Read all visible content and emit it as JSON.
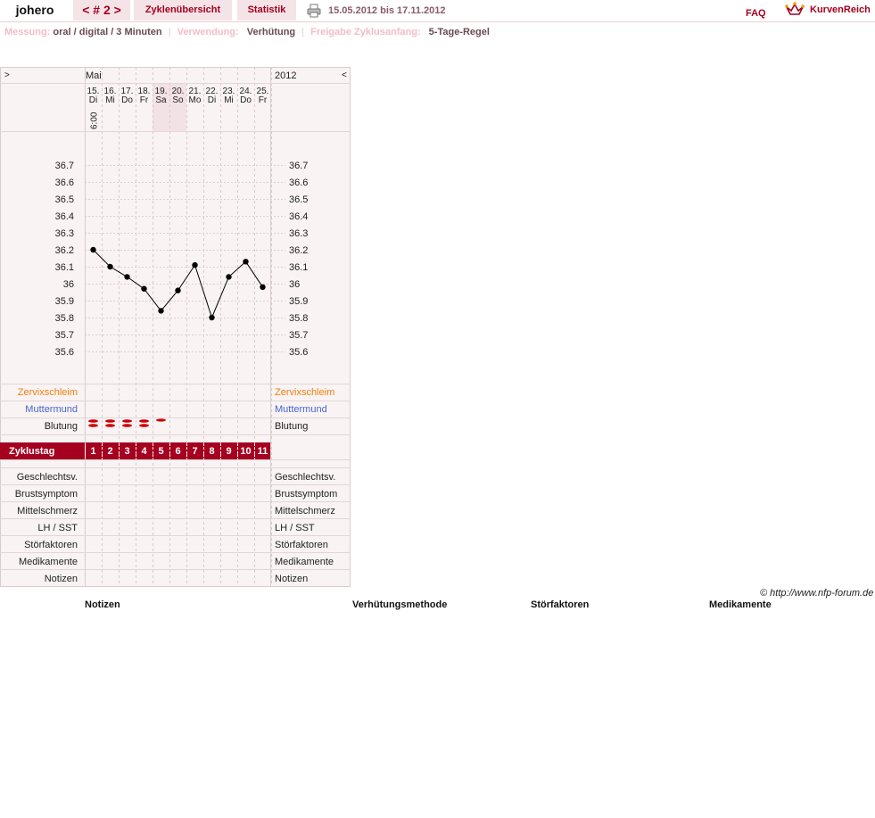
{
  "header": {
    "user": "johero",
    "cycle_nav": "< # 2 >",
    "tab_overview": "Zyklenübersicht",
    "tab_statistics": "Statistik",
    "print_icon": "printer-icon",
    "date_range": "15.05.2012 bis 17.11.2012",
    "faq": "FAQ",
    "logo_icon": "crown-icon",
    "logo_text": "KurvenReich"
  },
  "info": {
    "measurement_label": "Messung:",
    "measurement_value": "oral / digital / 3 Minuten",
    "usage_label": "Verwendung:",
    "usage_value": "Verhütung",
    "release_label": "Freigabe Zyklusanfang:",
    "release_value": "5-Tage-Regel"
  },
  "colors": {
    "accent": "#a5001f",
    "panel_bg": "#f9f3f3",
    "weekend_bg": "#f2e2e5",
    "cervix": "#f08010",
    "cervix_pos": "#4466cc",
    "bleeding": "#cc0000"
  },
  "chart_data": {
    "type": "line",
    "month": "Mai",
    "year": "2012",
    "prev_label": ">",
    "next_label": "<",
    "time_label": "6:00",
    "dates": [
      "15.",
      "16.",
      "17.",
      "18.",
      "19.",
      "20.",
      "21.",
      "22.",
      "23.",
      "24.",
      "25."
    ],
    "weekdays": [
      "Di",
      "Mi",
      "Do",
      "Fr",
      "Sa",
      "So",
      "Mo",
      "Di",
      "Mi",
      "Do",
      "Fr"
    ],
    "weekend_columns": [
      4,
      5
    ],
    "y_ticks": [
      "36.7",
      "36.6",
      "36.5",
      "36.4",
      "36.3",
      "36.2",
      "36.1",
      "36",
      "35.9",
      "35.8",
      "35.7",
      "35.6"
    ],
    "ylim": [
      35.6,
      36.7
    ],
    "temperatures": [
      36.2,
      36.1,
      36.04,
      35.97,
      35.84,
      35.96,
      36.11,
      35.8,
      36.04,
      36.13,
      35.98
    ],
    "bleeding": [
      "heavy",
      "heavy",
      "heavy",
      "heavy",
      "light",
      "",
      "",
      "",
      "",
      "",
      ""
    ],
    "cycle_days": [
      "1",
      "2",
      "3",
      "4",
      "5",
      "6",
      "7",
      "8",
      "9",
      "10",
      "11"
    ]
  },
  "rows": {
    "cervical_mucus": "Zervixschleim",
    "cervix": "Muttermund",
    "bleeding": "Blutung",
    "cycle_day": "Zyklustag",
    "intercourse": "Geschlechtsv.",
    "breast": "Brustsymptom",
    "mittelschmerz": "Mittelschmerz",
    "lh": "LH / SST",
    "disturbances": "Störfaktoren",
    "medication": "Medikamente",
    "notes": "Notizen"
  },
  "footer": {
    "copyright": "© http://www.nfp-forum.de",
    "notes": "Notizen",
    "contraception": "Verhütungsmethode",
    "disturbances": "Störfaktoren",
    "medication": "Medikamente"
  }
}
